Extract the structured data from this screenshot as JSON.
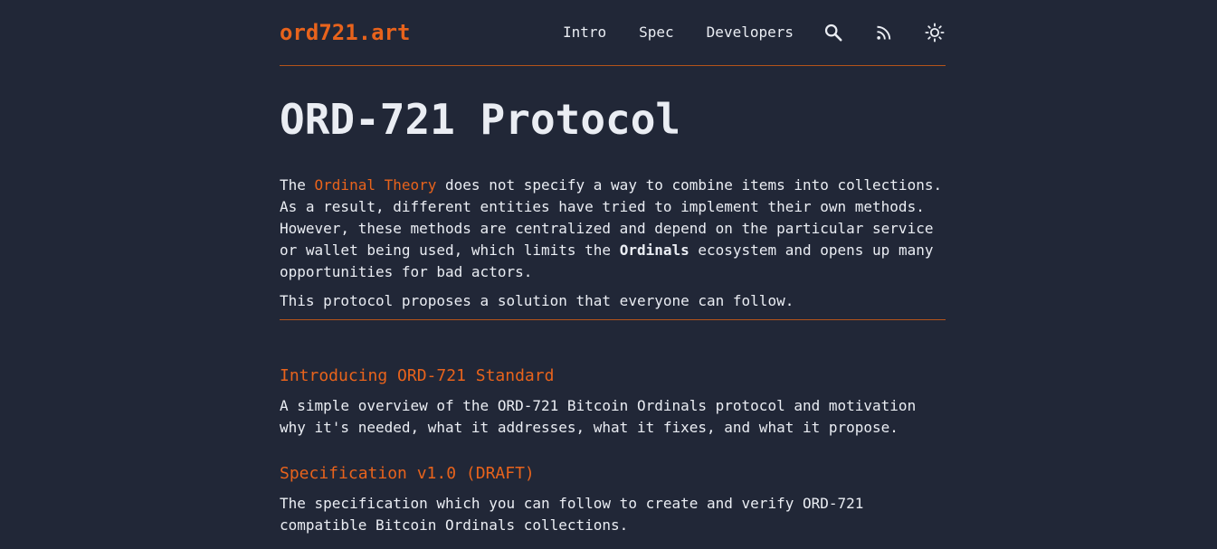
{
  "header": {
    "logo": "ord721.art",
    "nav": [
      {
        "label": "Intro"
      },
      {
        "label": "Spec"
      },
      {
        "label": "Developers"
      }
    ],
    "icons": [
      "search-icon",
      "rss-icon",
      "sun-icon"
    ]
  },
  "main": {
    "title": "ORD-721 Protocol",
    "intro": {
      "p1_before": "The ",
      "p1_link": "Ordinal Theory",
      "p1_middle": " does not specify a way to combine items into collections. As a result, different entities have tried to implement their own methods. However, these methods are centralized and depend on the particular service or wallet being used, which limits the ",
      "p1_strong": "Ordinals",
      "p1_after": " ecosystem and opens up many opportunities for bad actors.",
      "p2": "This protocol proposes a solution that everyone can follow."
    },
    "posts": [
      {
        "title": "Introducing ORD-721 Standard",
        "description": "A simple overview of the ORD-721 Bitcoin Ordinals protocol and motivation why it's needed, what it addresses, what it fixes, and what it propose."
      },
      {
        "title": "Specification v1.0 (DRAFT)",
        "description": "The specification which you can follow to create and verify ORD-721 compatible Bitcoin Ordinals collections."
      }
    ]
  },
  "colors": {
    "background": "#212737",
    "accent": "#e8631c",
    "text": "#eaedf3",
    "border": "#b4541a"
  }
}
